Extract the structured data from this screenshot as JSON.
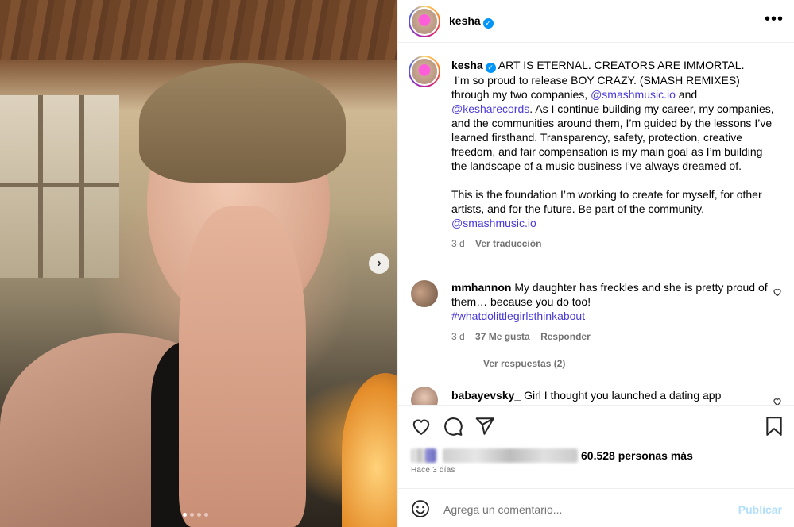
{
  "post": {
    "username": "kesha",
    "verified_mark": "✓",
    "caption_paragraph_1": "ART IS ETERNAL. CREATORS ARE IMMORTAL.\n I’m so proud to release BOY CRAZY. (SMASH REMIXES) through my two companies, ",
    "mention_1": "@smashmusic.io",
    "caption_and": " and",
    "mention_2": "@kesharecords",
    "caption_paragraph_1_rest": ". As I continue building my career, my companies, and the communities around them, I’m guided by the lessons I’ve learned firsthand. Transparency, safety, protection, creative freedom, and fair compensation is my main goal as I’m building the landscape of a music business I’ve always dreamed of.",
    "caption_paragraph_2": "This is the foundation I’m working to create for myself, for other artists, and for the future. Be part of the community.",
    "mention_3": "@smashmusic.io",
    "caption_time": "3 d",
    "translate_label": "Ver traducción",
    "carousel_index": 1,
    "carousel_total": 4,
    "next_icon": "›"
  },
  "comments": [
    {
      "username": "mmhannon",
      "text": "My daughter has freckles and she is pretty proud of them… because you do too!",
      "hashtag": "#whatdolittlegirlsthinkabout",
      "time": "3 d",
      "likes": "37 Me gusta",
      "reply_label": "Responder",
      "view_replies": "Ver respuestas (2)"
    },
    {
      "username": "babayevsky_",
      "text": "Girl I thought you launched a dating app"
    }
  ],
  "actions": {
    "likes_count": "60.528 personas más",
    "date": "Hace 3 días",
    "comment_placeholder": "Agrega un comentario...",
    "publish_label": "Publicar"
  },
  "colors": {
    "link": "#4a3ad8",
    "verified": "#0095f6",
    "publish_disabled": "#b2dffc"
  },
  "icons": [
    "heart-icon",
    "comment-icon",
    "share-icon",
    "bookmark-icon",
    "emoji-icon",
    "more-icon",
    "chevron-right-icon"
  ]
}
